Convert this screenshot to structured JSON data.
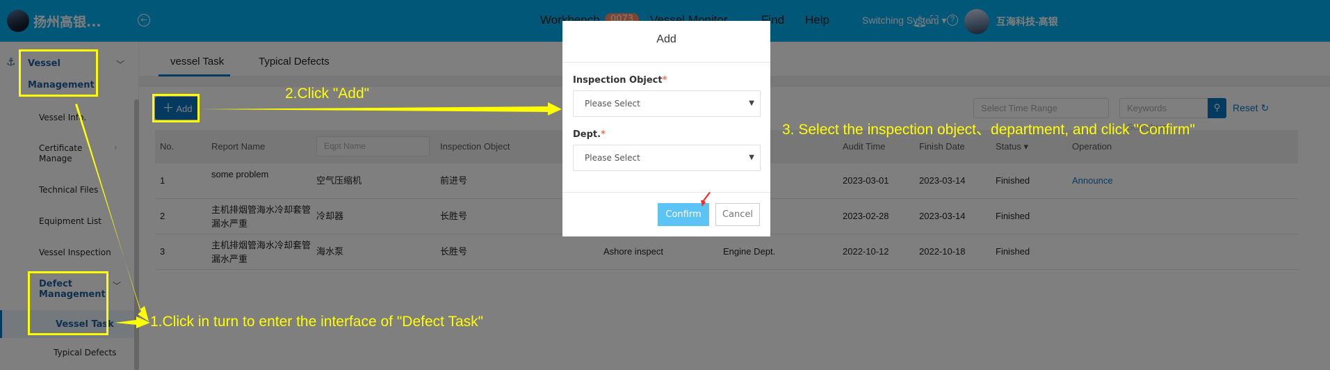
{
  "header": {
    "brand": "扬州高银...",
    "nav": [
      {
        "label": "Workbench",
        "badge": "0073"
      },
      {
        "label": "Vessel Monitor"
      },
      {
        "label": "Find"
      },
      {
        "label": "Help"
      }
    ],
    "switching_system": "Switching System ▾",
    "user": "互海科技-高银",
    "brand_color": "#00aef0"
  },
  "sidebar": {
    "group": "Vessel Management",
    "group_line1": "Vessel",
    "group_line2": "Management",
    "items": [
      {
        "label": "Vessel Info."
      },
      {
        "label_line1": "Certificate",
        "label_line2": "Manage"
      },
      {
        "label": "Technical Files"
      },
      {
        "label": "Equipment List"
      },
      {
        "label": "Vessel Inspection"
      }
    ],
    "sub_group_line1": "Defect",
    "sub_group_line2": "Management",
    "sub_items": [
      {
        "label": "Vessel Task",
        "active": true
      },
      {
        "label": "Typical Defects"
      }
    ]
  },
  "tabs": [
    {
      "label": "vessel Task",
      "active": true
    },
    {
      "label": "Typical Defects"
    }
  ],
  "toolbar": {
    "add": "Add",
    "time_range_placeholder": "Select Time Range",
    "keywords_placeholder": "Keywords Searching",
    "reset": "Reset"
  },
  "table": {
    "columns": [
      "No.",
      "Report Name",
      "Eqpt Name",
      "Inspection Object",
      "",
      "",
      "Audit Time",
      "Finish Date",
      "Status ▾",
      "Operation"
    ],
    "rows": [
      {
        "no": "1",
        "report": "some problem",
        "eqpt": "空气压缩机",
        "object": "前进号",
        "type": "",
        "dept": "",
        "audit": "2023-03-01",
        "finish": "2023-03-14",
        "status": "Finished",
        "op": "Announce"
      },
      {
        "no": "2",
        "report": "主机排烟管海水冷却套管漏水严重",
        "eqpt": "冷却器",
        "object": "长胜号",
        "type": "",
        "dept": "t.",
        "audit": "2023-02-28",
        "finish": "2023-03-14",
        "status": "Finished",
        "op": ""
      },
      {
        "no": "3",
        "report": "主机排烟管海水冷却套管漏水严重",
        "eqpt": "海水泵",
        "object": "长胜号",
        "type": "Ashore inspect",
        "dept": "Engine Dept.",
        "audit": "2022-10-12",
        "finish": "2022-10-18",
        "status": "Finished",
        "op": ""
      }
    ]
  },
  "modal": {
    "title": "Add",
    "field1_label": "Inspection Object",
    "field2_label": "Dept.",
    "required_mark": "*",
    "placeholder": "Please Select",
    "confirm": "Confirm",
    "cancel": "Cancel"
  },
  "annotations": {
    "step1": "1.Click in turn to enter the interface of \"Defect Task\"",
    "step2": "2.Click \"Add\"",
    "step3": "3. Select the inspection object、department, and click \"Confirm\"",
    "color": "#ffff00"
  }
}
